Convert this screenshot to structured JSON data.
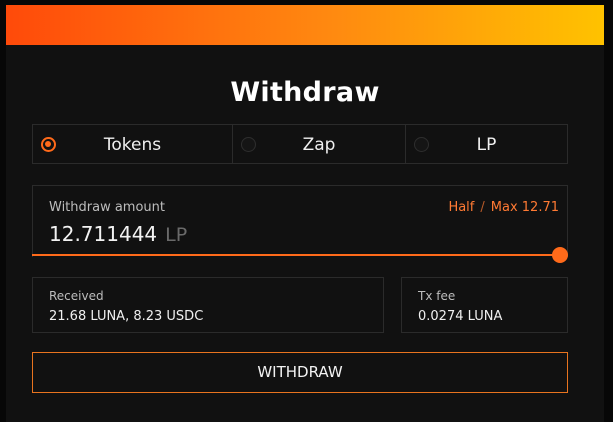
{
  "modal": {
    "title": "Withdraw",
    "colors": {
      "accent": "#ff6a1a",
      "gradient_start": "#ff4a0a",
      "gradient_end": "#ffc200",
      "background": "#111111"
    }
  },
  "tabs": [
    {
      "label": "Tokens",
      "selected": true
    },
    {
      "label": "Zap",
      "selected": false
    },
    {
      "label": "LP",
      "selected": false
    }
  ],
  "amount": {
    "label": "Withdraw amount",
    "half_label": "Half",
    "separator": "/",
    "max_label": "Max 12.71",
    "value": "12.711444",
    "unit": "LP",
    "slider_fraction": 1.0
  },
  "received": {
    "label": "Received",
    "value": "21.68 LUNA, 8.23 USDC"
  },
  "tx_fee": {
    "label": "Tx fee",
    "value": "0.0274 LUNA"
  },
  "action": {
    "label": "WITHDRAW"
  }
}
